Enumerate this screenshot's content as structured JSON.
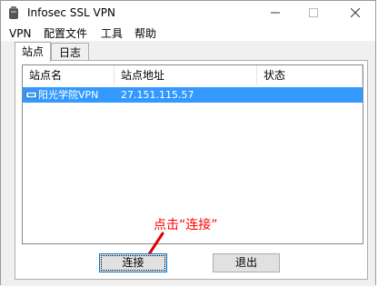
{
  "window": {
    "title": "Infosec SSL VPN"
  },
  "menu": [
    "VPN",
    "配置文件",
    "工具",
    "帮助"
  ],
  "tabs": [
    "站点",
    "日志"
  ],
  "list": {
    "headers": [
      "站点名",
      "站点地址",
      "状态"
    ],
    "rows": [
      {
        "name": "阳光学院VPN",
        "address": "27.151.115.57",
        "status": ""
      }
    ]
  },
  "annotation": "点击“连接”",
  "buttons": {
    "connect": "连接",
    "exit": "退出"
  },
  "colors": {
    "selection": "#3399ff",
    "annotation": "#ff0000",
    "default_button_border": "#0078d7"
  },
  "icons": {
    "app": "key-tube-icon",
    "site": "network-plug-icon"
  }
}
